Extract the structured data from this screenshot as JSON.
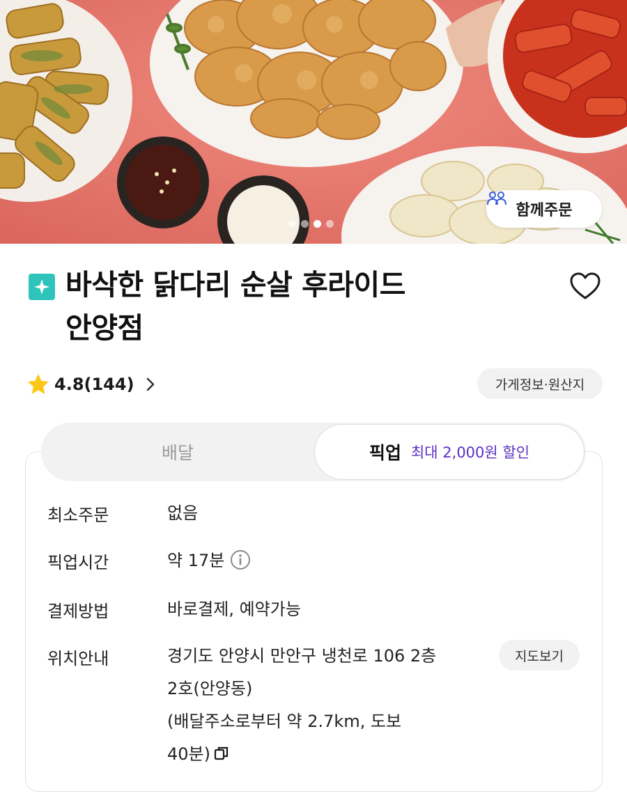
{
  "hero": {
    "together_order_label": "함께주문",
    "carousel": {
      "total": 4,
      "active_index": 2
    }
  },
  "store": {
    "name_line1": "바삭한 닭다리 순살 후라이드",
    "name_line2": "안양점",
    "rating": "4.8",
    "review_count": "(144)",
    "info_label": "가게정보·원산지"
  },
  "tabs": {
    "delivery": "배달",
    "pickup": "픽업",
    "pickup_discount": "최대 2,000원 할인"
  },
  "details": {
    "min_order": {
      "label": "최소주문",
      "value": "없음"
    },
    "pickup_time": {
      "label": "픽업시간",
      "value": "약 17분"
    },
    "payment": {
      "label": "결제방법",
      "value": "바로결제, 예약가능"
    },
    "location": {
      "label": "위치안내",
      "address_line1": "경기도 안양시 만안구 냉천로 106 2층",
      "address_line2": "2호(안양동)",
      "distance_line1": "(배달주소로부터 약 2.7km, 도보",
      "distance_line2": "40분)",
      "map_button": "지도보기"
    }
  },
  "colors": {
    "accent_purple": "#5a2fc2",
    "badge_teal": "#2ec4bb",
    "star_yellow": "#ffc61a"
  }
}
